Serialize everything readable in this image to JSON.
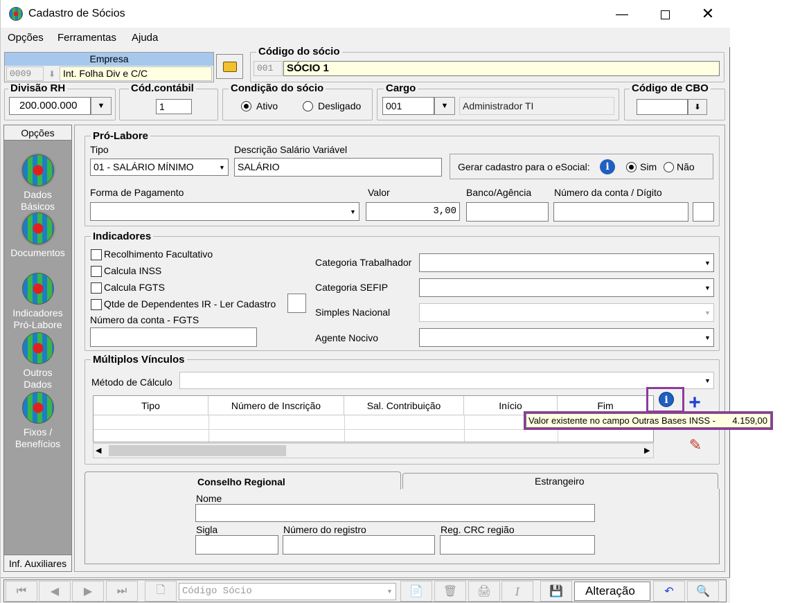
{
  "window": {
    "title": "Cadastro de Sócios"
  },
  "menu": {
    "opcoes": "Opções",
    "ferramentas": "Ferramentas",
    "ajuda": "Ajuda"
  },
  "empresa": {
    "header": "Empresa",
    "code": "0009",
    "name": "Int. Folha Div e C/C"
  },
  "codigo_socio": {
    "label": "Código do sócio",
    "code": "001",
    "name": "SÓCIO 1"
  },
  "divisao_rh": {
    "label": "Divisão RH",
    "value": "200.000.000"
  },
  "cod_contabil": {
    "label": "Cód.contábil",
    "value": "1"
  },
  "condicao": {
    "label": "Condição do sócio",
    "ativo": "Ativo",
    "desligado": "Desligado",
    "selected": "Ativo"
  },
  "cargo": {
    "label": "Cargo",
    "code": "001",
    "description": "Administrador TI"
  },
  "cbo": {
    "label": "Código de CBO",
    "value": ""
  },
  "sidebar": {
    "header": "Opções",
    "items": [
      {
        "label1": "Dados",
        "label2": "Básicos"
      },
      {
        "label1": "Documentos",
        "label2": ""
      },
      {
        "label1": "Indicadores",
        "label2": "Pró-Labore"
      },
      {
        "label1": "Outros",
        "label2": "Dados"
      },
      {
        "label1": "Fixos /",
        "label2": "Benefícios"
      }
    ],
    "footer": "Inf. Auxiliares"
  },
  "pro_labore": {
    "title": "Pró-Labore",
    "tipo_label": "Tipo",
    "tipo_value": "01 - SALÁRIO MÍNIMO",
    "desc_label": "Descrição Salário Variável",
    "desc_value": "SALÁRIO",
    "esocial_label": "Gerar cadastro para o eSocial:",
    "sim": "Sim",
    "nao": "Não",
    "esocial_selected": "Sim",
    "forma_label": "Forma de Pagamento",
    "forma_value": "",
    "valor_label": "Valor",
    "valor_value": "3,00",
    "banco_label": "Banco/Agência",
    "conta_label": "Número da conta / Dígito"
  },
  "indicadores": {
    "title": "Indicadores",
    "checks": [
      "Recolhimento Facultativo",
      "Calcula INSS",
      "Calcula FGTS",
      "Qtde de Dependentes IR - Ler Cadastro"
    ],
    "conta_fgts_label": "Número da conta - FGTS",
    "categoria_trab": "Categoria Trabalhador",
    "categoria_sefip": "Categoria SEFIP",
    "simples": "Simples Nacional",
    "agente": "Agente Nocivo"
  },
  "multiplos": {
    "title": "Múltiplos Vínculos",
    "metodo_label": "Método de Cálculo",
    "columns": [
      "Tipo",
      "Número de Inscrição",
      "Sal. Contribuição",
      "Início",
      "Fim"
    ],
    "tooltip_label": "Valor existente no campo Outras Bases INSS -",
    "tooltip_value": "4.159,00"
  },
  "tabs": {
    "conselho": "Conselho Regional",
    "estrangeiro": "Estrangeiro",
    "nome_label": "Nome",
    "sigla_label": "Sigla",
    "registro_label": "Número do registro",
    "crc_label": "Reg. CRC região"
  },
  "bottombar": {
    "search_placeholder": "Código Sócio",
    "status": "Alteração"
  },
  "colors": {
    "highlight_border": "#8e3a9e",
    "info_blue": "#1f5fbf",
    "plus_blue": "#1c3fd6",
    "yellow_field": "#ffffe1"
  }
}
